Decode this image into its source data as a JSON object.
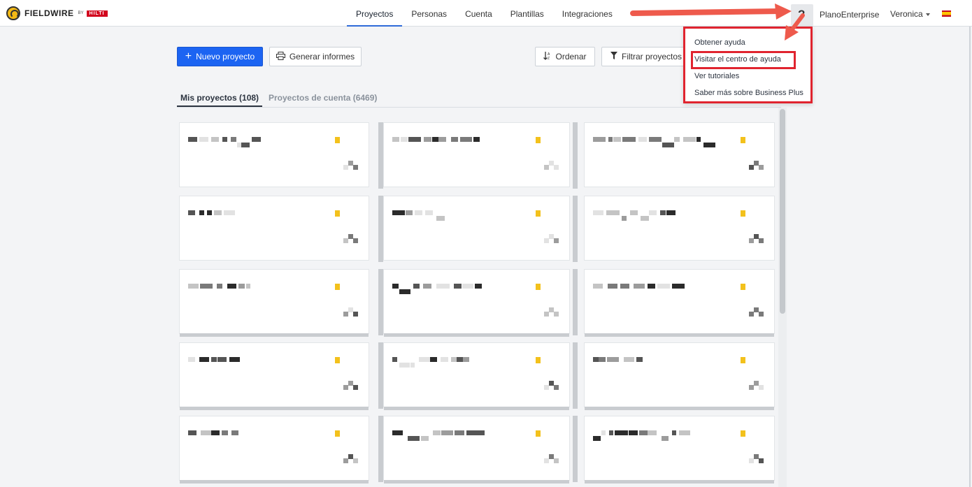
{
  "brand": {
    "name": "FIELDWIRE",
    "by": "BY",
    "partner": "HILTI"
  },
  "nav": {
    "items": [
      {
        "label": "Proyectos",
        "active": true
      },
      {
        "label": "Personas",
        "active": false
      },
      {
        "label": "Cuenta",
        "active": false
      },
      {
        "label": "Plantillas",
        "active": false
      },
      {
        "label": "Integraciones",
        "active": false
      }
    ],
    "help_icon": "question-circle-icon",
    "plan": "PlanoEnterprise",
    "user": "Veronica",
    "language_flag": "spain-flag-icon"
  },
  "toolbar": {
    "new_project": "Nuevo proyecto",
    "generate_reports": "Generar informes",
    "sort": "Ordenar",
    "filter": "Filtrar proyectos"
  },
  "tabs": {
    "mine": "Mis proyectos (108)",
    "account": "Proyectos de cuenta (6469)"
  },
  "help_menu": {
    "items": [
      "Obtener ayuda",
      "Visitar el centro de ayuda",
      "Ver tutoriales",
      "Saber más sobre Business Plus"
    ],
    "highlighted_index": 1
  },
  "colors": {
    "primary": "#1c64f2",
    "annotation_red": "#e0242f",
    "arrow": "#ee5a4c",
    "favorite_star": "#f3c11c"
  }
}
